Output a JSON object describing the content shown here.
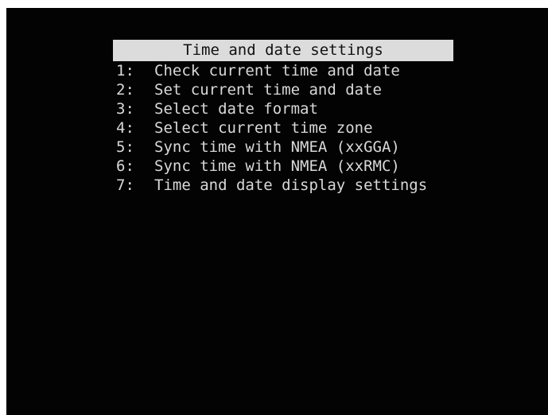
{
  "menu": {
    "title": "Time and date settings",
    "items": [
      {
        "key": "1:",
        "label": "Check current time and date"
      },
      {
        "key": "2:",
        "label": "Set current time and date"
      },
      {
        "key": "3:",
        "label": "Select date format"
      },
      {
        "key": "4:",
        "label": "Select current time zone"
      },
      {
        "key": "5:",
        "label": "Sync time with NMEA (xxGGA)"
      },
      {
        "key": "6:",
        "label": "Sync time with NMEA (xxRMC)"
      },
      {
        "key": "7:",
        "label": "Time and date display settings"
      }
    ]
  },
  "colors": {
    "screen_background": "#030303",
    "title_bar_background": "#dcdcdc",
    "title_text": "#111111",
    "item_text": "#d8d8d8"
  }
}
